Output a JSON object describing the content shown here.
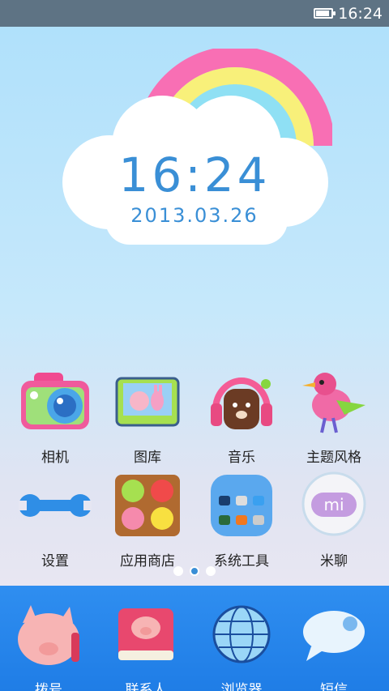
{
  "status_bar": {
    "time": "16:24",
    "battery_level": 0.9
  },
  "widget": {
    "time": "16:24",
    "date": "2013.03.26"
  },
  "apps": [
    {
      "label": "相机",
      "icon": "camera-icon"
    },
    {
      "label": "图库",
      "icon": "gallery-icon"
    },
    {
      "label": "音乐",
      "icon": "music-icon"
    },
    {
      "label": "主题风格",
      "icon": "bird-theme-icon"
    },
    {
      "label": "设置",
      "icon": "wrench-icon"
    },
    {
      "label": "应用商店",
      "icon": "fruit-box-icon"
    },
    {
      "label": "系统工具",
      "icon": "folder-tools-icon"
    },
    {
      "label": "米聊",
      "icon": "mi-chat-icon"
    }
  ],
  "pager": {
    "count": 3,
    "active": 2
  },
  "dock": [
    {
      "label": "拨号",
      "icon": "pig-phone-icon"
    },
    {
      "label": "联系人",
      "icon": "pig-book-icon"
    },
    {
      "label": "浏览器",
      "icon": "globe-icon"
    },
    {
      "label": "短信",
      "icon": "chat-bubble-icon"
    }
  ],
  "colors": {
    "accent": "#3a8fd6",
    "dock": "#2486ec",
    "status_bar": "#5e7384"
  }
}
